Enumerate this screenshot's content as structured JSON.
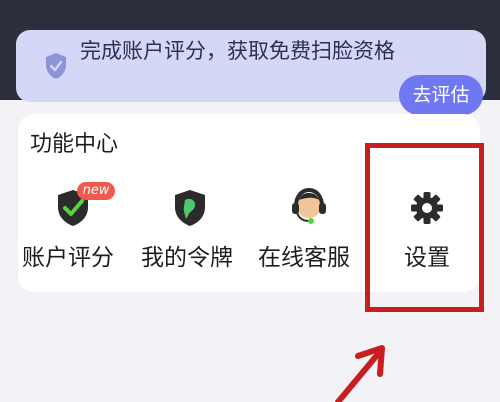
{
  "banner": {
    "message": "完成账户评分，获取免费扫脸资格",
    "action_label": "去评估",
    "icon": "shield-check-icon"
  },
  "function_center": {
    "title": "功能中心",
    "items": [
      {
        "label": "账户评分",
        "icon": "shield-check-icon",
        "badge": "new"
      },
      {
        "label": "我的令牌",
        "icon": "token-shield-icon"
      },
      {
        "label": "在线客服",
        "icon": "customer-service-icon"
      },
      {
        "label": "设置",
        "icon": "gear-icon"
      }
    ]
  },
  "colors": {
    "banner_bg": "#d5d7f6",
    "accent": "#6f78f0",
    "highlight": "#c81e1e",
    "badge": "#ef5a4c"
  }
}
